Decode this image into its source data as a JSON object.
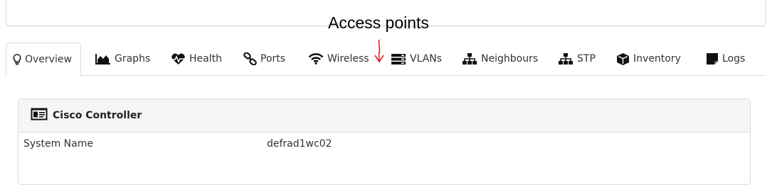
{
  "annotation": {
    "text": "Access points",
    "arrow_color": "#e02020"
  },
  "tabs": [
    {
      "label": "Overview",
      "icon": "lightbulb-icon",
      "active": true
    },
    {
      "label": "Graphs",
      "icon": "area-chart-icon"
    },
    {
      "label": "Health",
      "icon": "heartbeat-icon"
    },
    {
      "label": "Ports",
      "icon": "link-icon"
    },
    {
      "label": "Wireless",
      "icon": "wifi-icon"
    },
    {
      "label": "VLANs",
      "icon": "server-icon"
    },
    {
      "label": "Neighbours",
      "icon": "sitemap-icon"
    },
    {
      "label": "STP",
      "icon": "sitemap-icon"
    },
    {
      "label": "Inventory",
      "icon": "cube-icon"
    },
    {
      "label": "Logs",
      "icon": "sticky-note-icon"
    }
  ],
  "panel": {
    "title": "Cisco Controller",
    "icon": "id-card-icon",
    "rows": [
      {
        "key": "System Name",
        "value": "defrad1wc02"
      }
    ]
  }
}
